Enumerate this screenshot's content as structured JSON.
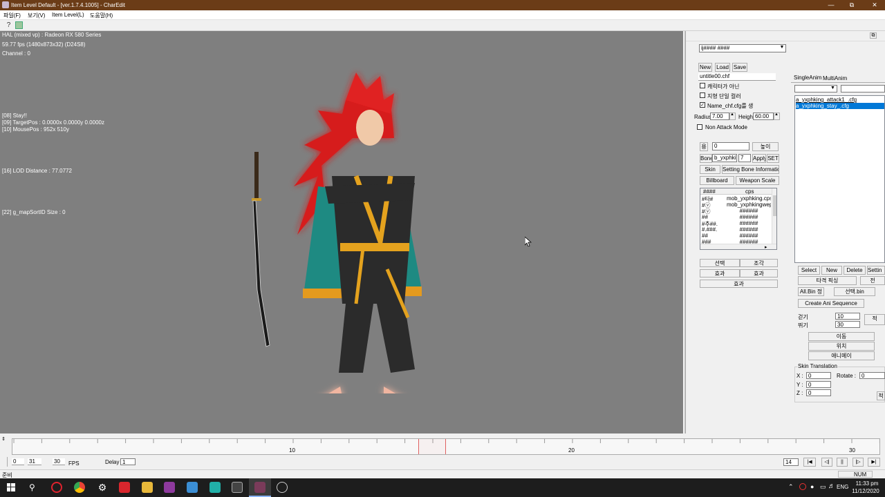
{
  "window": {
    "title": "Item Level Default - [ver.1.7.4.1005] - CharEdit"
  },
  "menu": [
    "파일(F)",
    "보기(V)",
    "Item Level(L)",
    "도움말(H)"
  ],
  "debug": {
    "gpu": "HAL (mixed vp) : Radeon RX 580 Series",
    "fps": "59.77 fps (1480x873x32) (D24S8)",
    "channel": "Channel :   0",
    "stay": "[08]  Stay!!",
    "target": "[09]  TargetPos : 0.0000x 0.0000y 0.0000z",
    "mouse": "[10]  MousePos : 952x 510y",
    "lod": "[16]  LOD Distance : 77.0772",
    "sort": "[22]  g_mapSortID Size : 0"
  },
  "panel": {
    "combo_value": "ij#### ####",
    "new": "New",
    "load": "Load",
    "save": "Save",
    "filename": "untitle00.chf",
    "chk1": "캐릭터가 아닌",
    "chk2": "지형 단일 컬러",
    "chk3": "Name_chf.cfg를 생",
    "radius_label": "Radius",
    "radius_value": "7.00",
    "height_label": "Height",
    "height_value": "60.00",
    "non_attack": "Non Attack Mode",
    "small_btn": "용",
    "bone_value": "0",
    "high_btn": "높이",
    "bone_btn": "Bone",
    "bone_name": "b_yxphkin;",
    "bone_num": "7",
    "apply": "Apply",
    "set": "SET",
    "skin": "Skin",
    "setting_bone": "Setting Bone Information",
    "billboard": "Billboard",
    "weapon_scale": "Weapon Scale",
    "grid_headers": [
      "####",
      "cps"
    ],
    "grid_rows": [
      [
        "#타#",
        "mob_yxphking.cps"
      ],
      [
        "#ⓥ",
        "mob_yxphkingwep"
      ],
      [
        "#ⓥ",
        "######"
      ],
      [
        "##",
        "######"
      ],
      [
        "#추##.",
        "######"
      ],
      [
        "#.###.",
        "######"
      ],
      [
        "##",
        "######"
      ],
      [
        "###",
        "######"
      ]
    ],
    "sel_btn": "선택",
    "rotate_btn": "조각",
    "effect1": "효과",
    "effect2": "효과",
    "effect3": "효과"
  },
  "anim": {
    "tab1": "SingleAnim",
    "tab2": "MultiAnim",
    "items": [
      "a_yxphking_attack1_.cfg",
      "a_yxphking_stay_.cfg"
    ],
    "select": "Select",
    "new": "New",
    "delete": "Delete",
    "setting": "Settin",
    "hit_fix": "타격 픽싱",
    "jeon": "전",
    "allbin": "All.Bin 정",
    "selbin": "선택.bin",
    "create_seq": "Create Ani Sequence",
    "walk_label": "걷기",
    "walk_value": "10",
    "run_label": "뛰기",
    "run_value": "30",
    "apply_btn": "적",
    "move": "이동",
    "pos": "위치",
    "ani": "애니메이",
    "skin_translation": "Skin Translation",
    "x_label": "X :",
    "x_value": "0",
    "y_label": "Y :",
    "y_value": "0",
    "z_label": "Z :",
    "z_value": "0",
    "rotate_label": "Rotate :",
    "rotate_value": "0",
    "apply2": "적"
  },
  "timeline": {
    "ticks": [
      "10",
      "20",
      "30"
    ],
    "start": "0",
    "end": "31",
    "fps_value": "30",
    "fps_label": "FPS",
    "delay_label": "Delay",
    "delay_value": "1",
    "frame_value": "14"
  },
  "status": {
    "left": "준비",
    "num": "NUM"
  },
  "taskbar": {
    "lang": "ENG",
    "time": "11:33 pm",
    "date": "11/12/2020"
  },
  "colors": {
    "title": "#6b3c17",
    "viewport": "#7f7f7f",
    "selection": "#0078d7"
  }
}
